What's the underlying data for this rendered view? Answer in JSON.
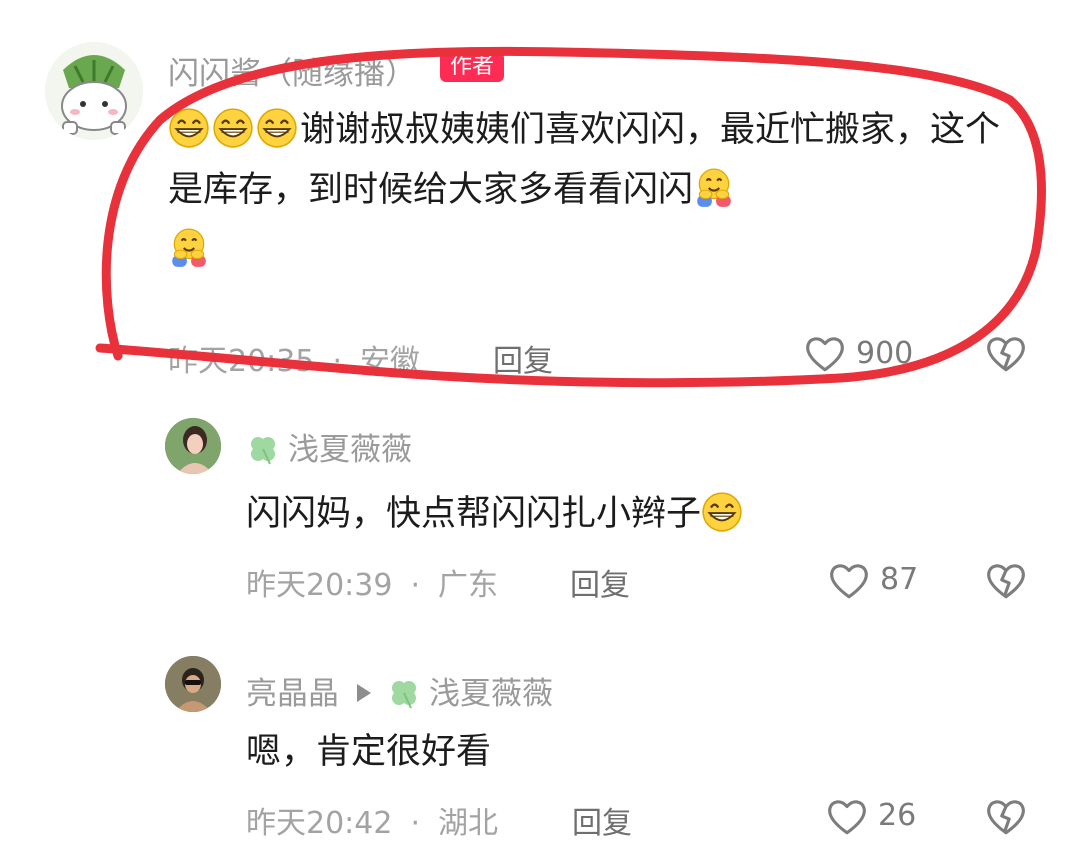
{
  "comments": [
    {
      "author": "闪闪酱（随缘播）",
      "badge": "作者",
      "text_after_emoji": "谢谢叔叔姨姨们喜欢闪闪，最近忙搬家，这个是库存，到时候给大家多看看闪闪",
      "time": "昨天20:35",
      "location": "安徽",
      "reply_label": "回复",
      "likes": "900"
    },
    {
      "author": "浅夏薇薇",
      "text": "闪闪妈，快点帮闪闪扎小辫子",
      "time": "昨天20:39",
      "location": "广东",
      "reply_label": "回复",
      "likes": "87"
    },
    {
      "author": "亮晶晶",
      "reply_to": "浅夏薇薇",
      "text": "嗯，肯定很好看",
      "time": "昨天20:42",
      "location": "湖北",
      "reply_label": "回复",
      "likes": "26"
    }
  ],
  "colors": {
    "accent_badge": "#fe2c55",
    "highlight_circle": "#e8313a",
    "meta_text": "#a3a3a3"
  },
  "icons": [
    "grinning-emoji-icon",
    "hugging-emoji-icon",
    "clover-icon",
    "heart-icon",
    "dislike-heart-icon",
    "reply-arrow-icon"
  ]
}
